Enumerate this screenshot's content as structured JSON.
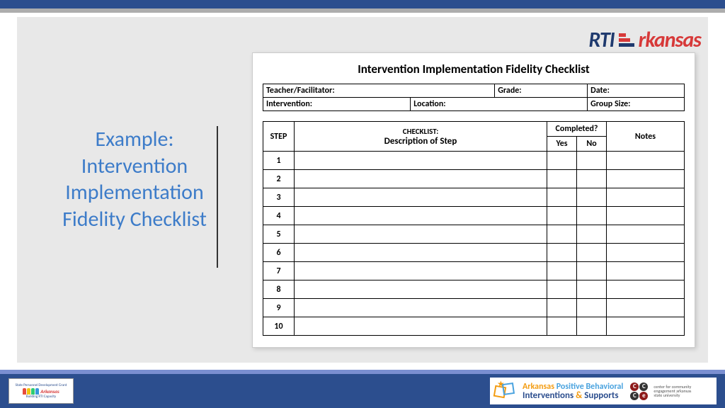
{
  "logo": {
    "rti": "RTI",
    "arkansas": "rkansas"
  },
  "side_title": "Example: Intervention Implementation Fidelity Checklist",
  "doc": {
    "title": "Intervention Implementation Fidelity Checklist",
    "info": {
      "teacher_label": "Teacher/Facilitator:",
      "grade_label": "Grade:",
      "date_label": "Date:",
      "intervention_label": "Intervention:",
      "location_label": "Location:",
      "groupsize_label": "Group Size:"
    },
    "headers": {
      "step": "STEP",
      "checklist": "CHECKLIST:",
      "description": "Description of Step",
      "completed": "Completed?",
      "yes": "Yes",
      "no": "No",
      "notes": "Notes"
    },
    "steps": [
      "1",
      "2",
      "3",
      "4",
      "5",
      "6",
      "7",
      "8",
      "9",
      "10"
    ]
  },
  "footer": {
    "left": {
      "arc_top": "State Personnel Development Grant",
      "mini": "Arkansas",
      "caption": "Building RTI Capacity"
    },
    "right": {
      "line1_a": "Arkansas ",
      "line1_b": "Positive Behavioral",
      "line2_a": "Interventions ",
      "line2_amp": "& ",
      "line2_b": "Supports",
      "cce": "center for community engagement arkansas state university"
    }
  }
}
